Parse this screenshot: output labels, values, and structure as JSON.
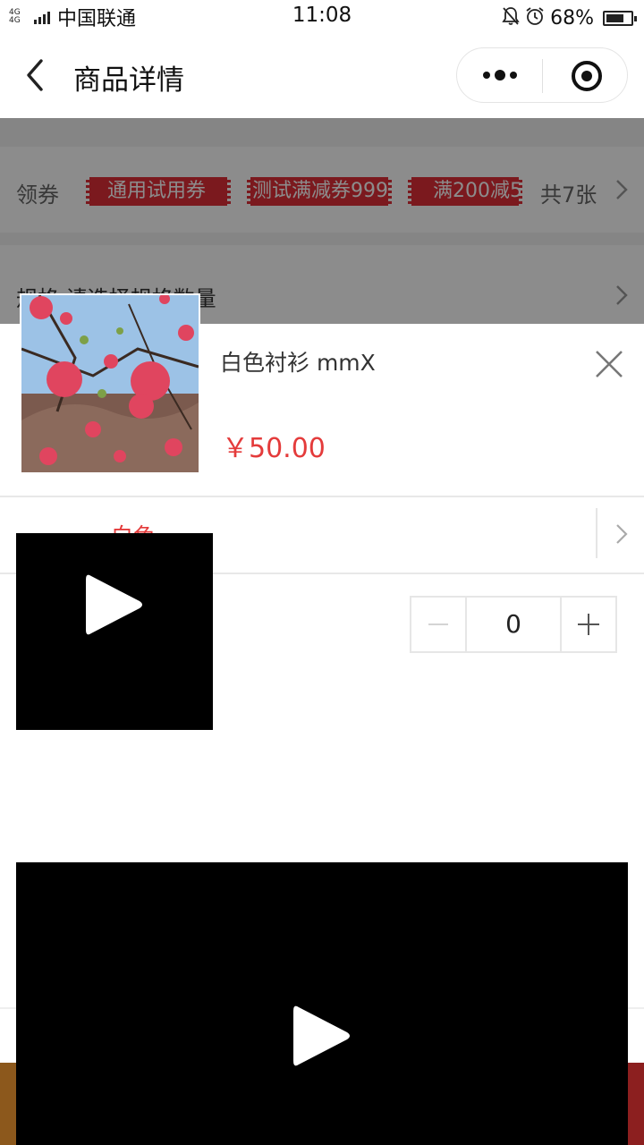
{
  "status_bar": {
    "network": "4G 4G",
    "carrier": "中国联通",
    "time": "11:08",
    "battery": "68%",
    "icons": [
      "mute-bell-icon",
      "alarm-icon",
      "battery-icon"
    ]
  },
  "nav": {
    "title": "商品详情",
    "back_icon": "chevron-left-icon",
    "more_icon": "more-dots-icon",
    "close_icon": "target-icon"
  },
  "coupons": {
    "label": "领券",
    "items": [
      "通用试用券",
      "测试满减券999",
      "满200减5"
    ],
    "count": "共7张"
  },
  "spec": {
    "label": "规格",
    "value": "请选择规格数量"
  },
  "sheet": {
    "product_name": "白色衬衫 mmX",
    "price": "￥50.00",
    "color_option": "白色",
    "quantity": "0"
  },
  "colors": {
    "coupon_red": "#e02e38",
    "price_red": "#e43b3b",
    "cart_orange": "#ffa033",
    "buy_red": "#ff3a3a"
  }
}
